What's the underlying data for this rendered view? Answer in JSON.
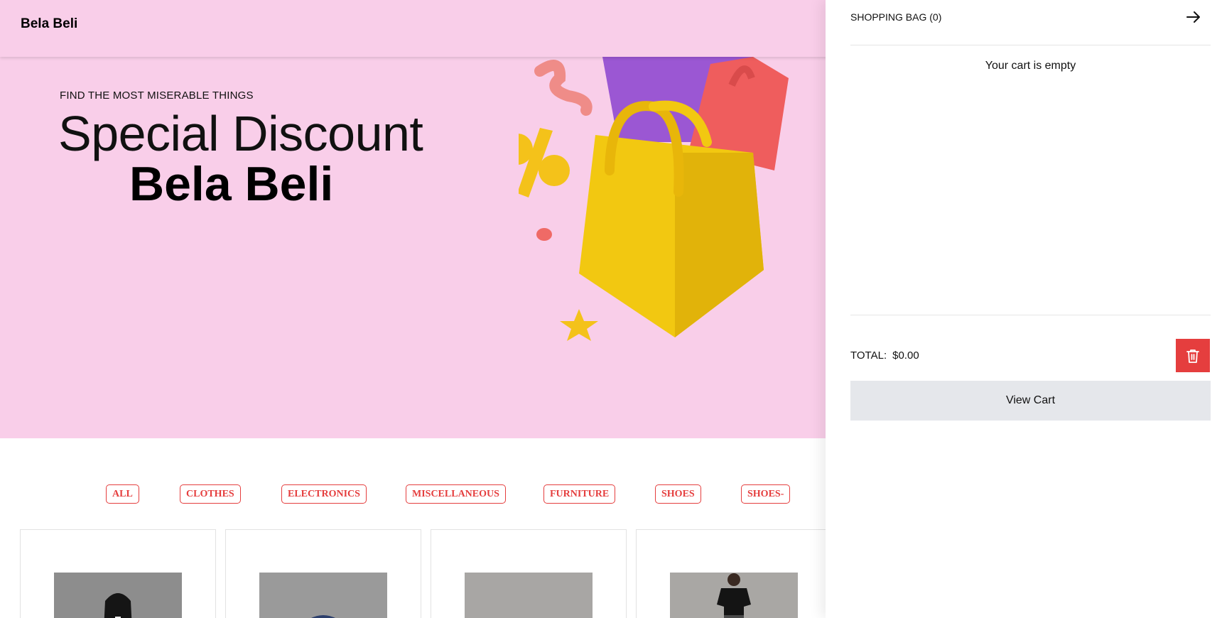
{
  "navbar": {
    "brand": "Bela Beli"
  },
  "hero": {
    "kicker": "FIND THE MOST MISERABLE THINGS",
    "title": "Special Discount",
    "brand": "Bela Beli"
  },
  "filters": {
    "items": [
      "ALL",
      "CLOTHES",
      "ELECTRONICS",
      "MISCELLANEOUS",
      "FURNITURE",
      "SHOES",
      "SHOES-"
    ]
  },
  "products": {
    "items": [
      {
        "image": "black-hoodie"
      },
      {
        "image": "navy-cap"
      },
      {
        "image": "light-blue-cap"
      },
      {
        "image": "black-tshirt-model"
      }
    ]
  },
  "cart": {
    "title": "SHOPPING BAG (0)",
    "close_icon": "arrow-right-icon",
    "empty_message": "Your cart is empty",
    "total_label": "TOTAL:",
    "total_value": "$0.00",
    "clear_icon": "trash-icon",
    "view_cart_label": "View Cart"
  },
  "colors": {
    "hero_bg": "#f9cee9",
    "accent_red": "#e53e3e",
    "button_gray": "#e5e7eb"
  }
}
